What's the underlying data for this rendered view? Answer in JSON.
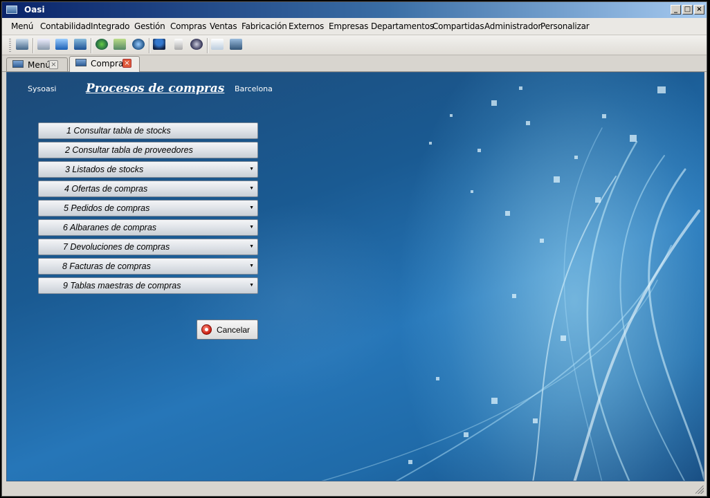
{
  "window": {
    "title": "Oasi"
  },
  "menubar": {
    "items": [
      "Menú",
      "Contabilidad",
      "Integrado",
      "Gestión",
      "Compras",
      "Ventas",
      "Fabricación",
      "Externos",
      "Empresas",
      "Departamentos",
      "Compartidas",
      "Administrador",
      "Personalizar"
    ]
  },
  "tabs": [
    {
      "label": "Menú",
      "close": "×"
    },
    {
      "label": "Compras",
      "close": "×"
    }
  ],
  "header": {
    "user": "Sysoasi",
    "title": "Procesos de compras",
    "city": "Barcelona"
  },
  "options": [
    {
      "label": "1  Consultar tabla de stocks",
      "submenu": false
    },
    {
      "label": "2  Consultar tabla de proveedores",
      "submenu": false
    },
    {
      "label": "3  Listados de stocks",
      "submenu": true
    },
    {
      "label": "4  Ofertas de compras",
      "submenu": true
    },
    {
      "label": "5  Pedidos de compras",
      "submenu": true
    },
    {
      "label": "6  Albaranes de compras",
      "submenu": true
    },
    {
      "label": "7  Devoluciones de compras",
      "submenu": true
    },
    {
      "label": "8  Facturas de compras",
      "submenu": true
    },
    {
      "label": "9  Tablas maestras de compras",
      "submenu": true
    }
  ],
  "submenu_arrow": "▼",
  "cancel": {
    "label": "Cancelar"
  },
  "winbtns": {
    "minimize": "_",
    "maximize": "□",
    "close": "×"
  },
  "toolbar_icons": [
    "display-icon",
    "scanner-icon",
    "monitor-icon",
    "window-icon",
    "gear-green-icon",
    "refresh-icon",
    "globe-icon",
    "user-icon",
    "clipboard-icon",
    "info-icon",
    "calendar-icon",
    "book-icon"
  ]
}
